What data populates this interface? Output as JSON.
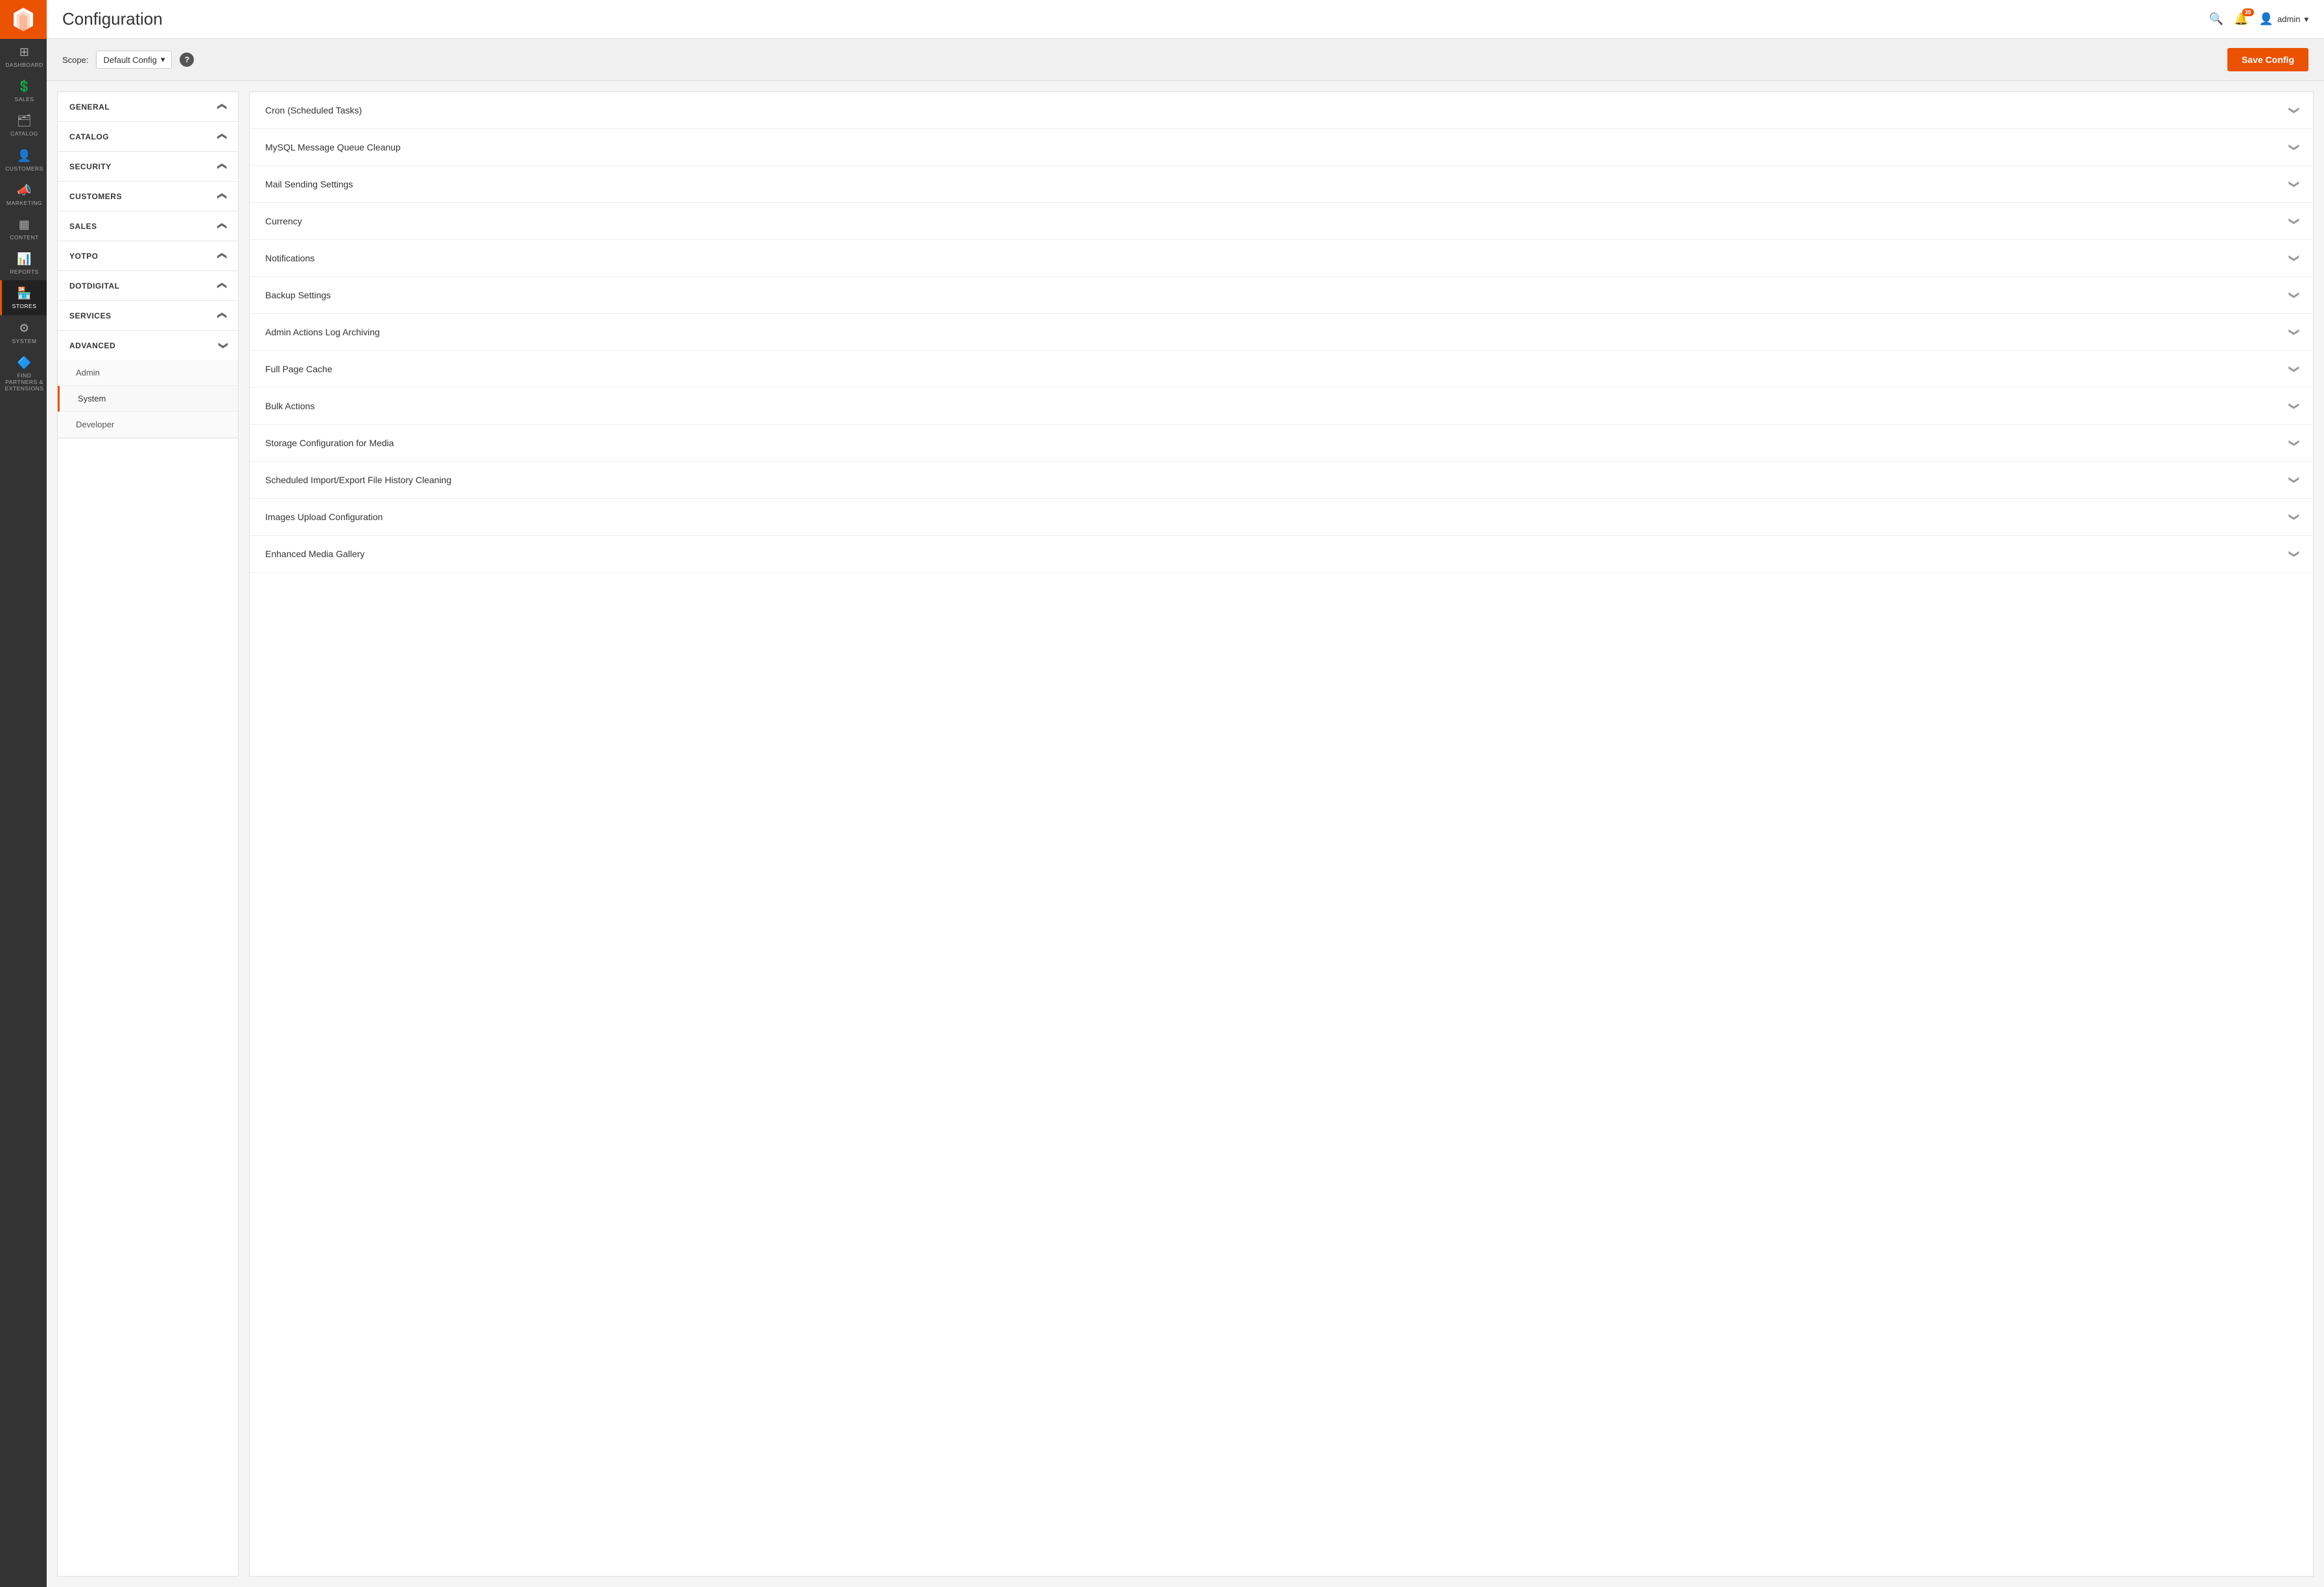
{
  "app": {
    "title": "Configuration",
    "logo_alt": "Magento Logo"
  },
  "sidebar": {
    "items": [
      {
        "id": "dashboard",
        "label": "DASHBOARD",
        "icon": "⊞"
      },
      {
        "id": "sales",
        "label": "SALES",
        "icon": "💲"
      },
      {
        "id": "catalog",
        "label": "CATALOG",
        "icon": "🗂"
      },
      {
        "id": "customers",
        "label": "CUSTOMERS",
        "icon": "👤"
      },
      {
        "id": "marketing",
        "label": "MARKETING",
        "icon": "📣"
      },
      {
        "id": "content",
        "label": "CONTENT",
        "icon": "▦"
      },
      {
        "id": "reports",
        "label": "REPORTS",
        "icon": "📊"
      },
      {
        "id": "stores",
        "label": "STORES",
        "icon": "🏪",
        "active": true
      },
      {
        "id": "system",
        "label": "SYSTEM",
        "icon": "⚙"
      },
      {
        "id": "find-partners",
        "label": "FIND PARTNERS & EXTENSIONS",
        "icon": "🔷"
      }
    ]
  },
  "header": {
    "title": "Configuration",
    "notification_count": "39",
    "admin_label": "admin",
    "search_icon": "search-icon",
    "bell_icon": "bell-icon",
    "user_icon": "user-icon",
    "chevron_icon": "chevron-down-icon"
  },
  "scope_bar": {
    "scope_label": "Scope:",
    "scope_value": "Default Config",
    "help_icon": "?",
    "save_button_label": "Save Config"
  },
  "left_nav": {
    "sections": [
      {
        "id": "general",
        "label": "GENERAL",
        "expanded": false,
        "sub_items": []
      },
      {
        "id": "catalog",
        "label": "CATALOG",
        "expanded": false,
        "sub_items": []
      },
      {
        "id": "security",
        "label": "SECURITY",
        "expanded": false,
        "sub_items": []
      },
      {
        "id": "customers",
        "label": "CUSTOMERS",
        "expanded": false,
        "sub_items": []
      },
      {
        "id": "sales",
        "label": "SALES",
        "expanded": false,
        "sub_items": []
      },
      {
        "id": "yotpo",
        "label": "YOTPO",
        "expanded": false,
        "sub_items": []
      },
      {
        "id": "dotdigital",
        "label": "DOTDIGITAL",
        "expanded": false,
        "sub_items": []
      },
      {
        "id": "services",
        "label": "SERVICES",
        "expanded": false,
        "sub_items": []
      },
      {
        "id": "advanced",
        "label": "ADVANCED",
        "expanded": true,
        "sub_items": [
          {
            "id": "admin",
            "label": "Admin",
            "active": false
          },
          {
            "id": "system",
            "label": "System",
            "active": true
          },
          {
            "id": "developer",
            "label": "Developer",
            "active": false
          }
        ]
      }
    ]
  },
  "config_items": [
    {
      "id": "cron",
      "label": "Cron (Scheduled Tasks)"
    },
    {
      "id": "mysql-queue",
      "label": "MySQL Message Queue Cleanup"
    },
    {
      "id": "mail-sending",
      "label": "Mail Sending Settings"
    },
    {
      "id": "currency",
      "label": "Currency"
    },
    {
      "id": "notifications",
      "label": "Notifications"
    },
    {
      "id": "backup",
      "label": "Backup Settings"
    },
    {
      "id": "admin-actions-log",
      "label": "Admin Actions Log Archiving"
    },
    {
      "id": "full-page-cache",
      "label": "Full Page Cache"
    },
    {
      "id": "bulk-actions",
      "label": "Bulk Actions"
    },
    {
      "id": "storage-config",
      "label": "Storage Configuration for Media"
    },
    {
      "id": "scheduled-import",
      "label": "Scheduled Import/Export File History Cleaning"
    },
    {
      "id": "images-upload",
      "label": "Images Upload Configuration"
    },
    {
      "id": "enhanced-media",
      "label": "Enhanced Media Gallery"
    }
  ]
}
